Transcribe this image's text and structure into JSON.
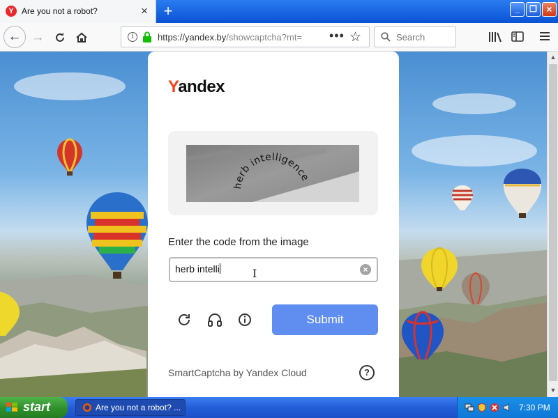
{
  "browser": {
    "tab_title": "Are you not a robot?",
    "tab_favicon_letter": "Y",
    "url_main": "https://yandex.by",
    "url_path": "/showcaptcha?mt=",
    "search_placeholder": "Search"
  },
  "captcha": {
    "logo_first": "Y",
    "logo_rest": "andex",
    "captcha_text": "herb intelligence",
    "prompt": "Enter the code from the image",
    "input_value": "herb intelli",
    "submit_label": "Submit",
    "footer": "SmartCaptcha by Yandex Cloud"
  },
  "taskbar": {
    "start_label": "start",
    "task_title": "Are you not a robot? ...",
    "clock": "7:30 PM"
  },
  "colors": {
    "accent": "#5f8ef0",
    "yandex_red": "#fc3f1d",
    "xp_blue": "#245ed8",
    "start_green": "#2e8f2a"
  }
}
